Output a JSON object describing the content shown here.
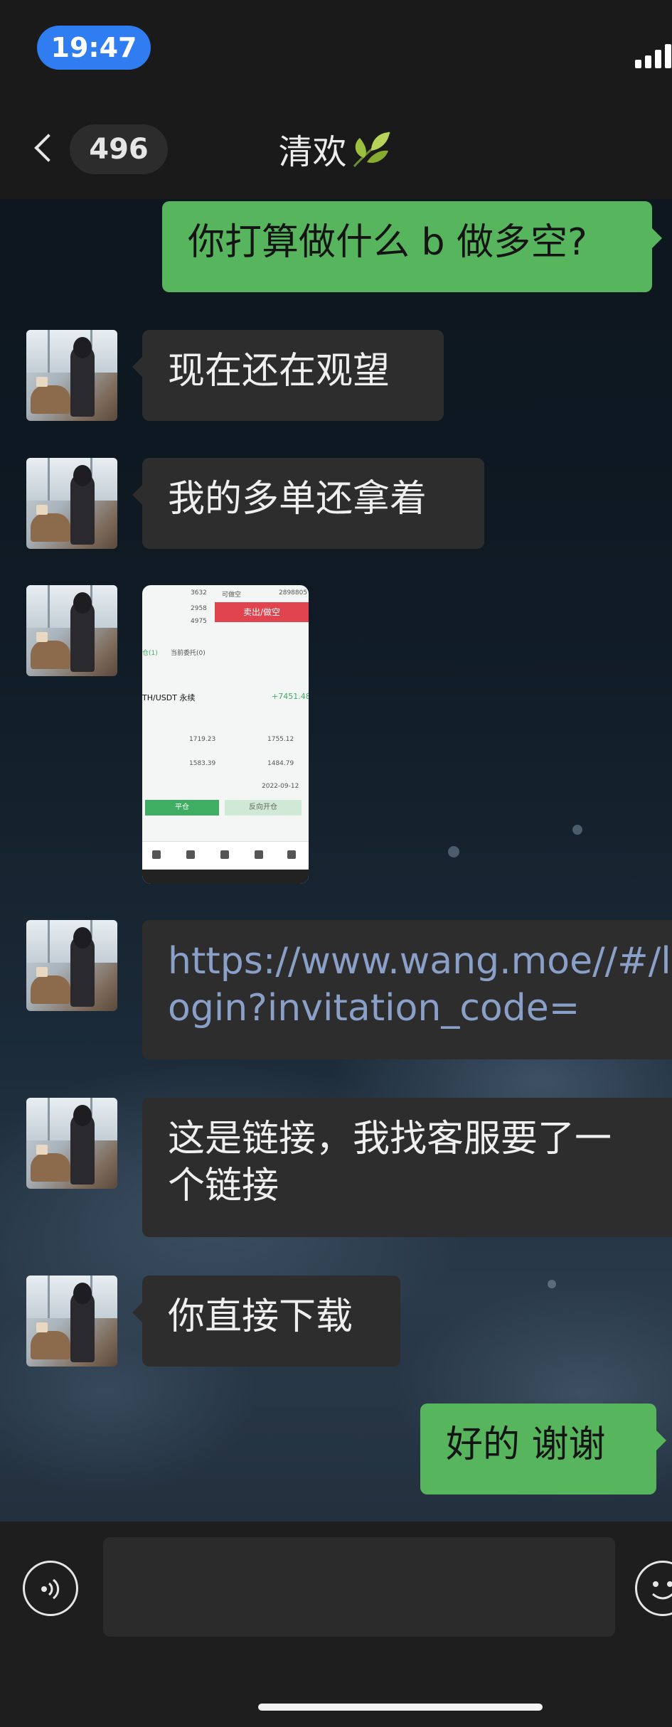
{
  "status_bar": {
    "time": "19:47"
  },
  "header": {
    "back_count": "496",
    "title": "清欢"
  },
  "messages": [
    {
      "sender": "me",
      "text": "你打算做什么 b 做多空?"
    },
    {
      "sender": "contact",
      "text": "现在还在观望"
    },
    {
      "sender": "contact",
      "text": "我的多单还拿着"
    },
    {
      "sender": "contact",
      "type": "image",
      "image": {
        "top_values": [
          "3632",
          "可做空",
          "2898805",
          "2958",
          "4975"
        ],
        "sell_button": "卖出/做空",
        "tabs": [
          "仓(1)",
          "当前委托(0)"
        ],
        "pair": "TH/USDT 永续",
        "profit": "+7451.48",
        "rows": [
          "1719.23",
          "1755.12",
          "1583.39",
          "1484.79",
          "2022-09-12"
        ],
        "buttons": [
          "平仓",
          "反向开仓"
        ]
      }
    },
    {
      "sender": "contact",
      "type": "link",
      "lines": [
        "https://www.wang.moe//#/l",
        "ogin?invitation_code="
      ]
    },
    {
      "sender": "contact",
      "lines": [
        "这是链接，我找客服要了一",
        "个链接"
      ]
    },
    {
      "sender": "contact",
      "text": "你直接下载"
    },
    {
      "sender": "me",
      "text": "好的 谢谢"
    }
  ],
  "input": {
    "placeholder": "",
    "value": ""
  },
  "icons": {
    "back": "chevron-left-icon",
    "title_emoji": "leaf-icon",
    "voice": "voice-icon",
    "emoji": "emoji-icon",
    "signal": "signal-icon"
  },
  "colors": {
    "my_bubble": "#57b55e",
    "their_bubble": "#2d2d2d",
    "time_pill": "#2f7df0",
    "link_text": "#8ba0c9"
  }
}
